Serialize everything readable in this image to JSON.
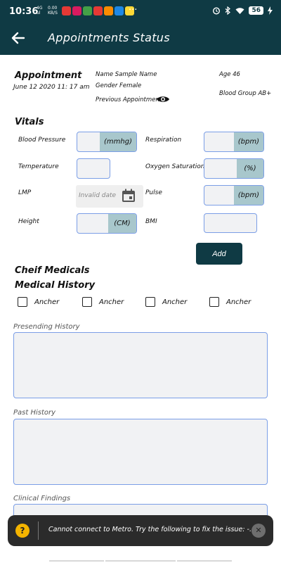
{
  "statusbar": {
    "time": "10:36",
    "signal_top": "4G",
    "signal_bottom": "ul",
    "net_top": "0.00",
    "net_bottom": "KB/S",
    "more": "···",
    "battery": "56",
    "notif_colors": [
      "#e53935",
      "#d81b60",
      "#43a047",
      "#e53935",
      "#fb8c00",
      "#1e88e5",
      "#fdd835"
    ]
  },
  "appbar": {
    "title": "Appointments Status"
  },
  "appointment": {
    "title": "Appointment",
    "date": "June 12 2020 11: 17 am",
    "name": "Name Sample Name",
    "gender": "Gender Female",
    "previous": "Previous Appointment",
    "age": "Age 46",
    "blood_group": "Blood Group AB+"
  },
  "vitals": {
    "title": "Vitals",
    "blood_pressure": {
      "label": "Blood Pressure",
      "unit": "(mmhg)"
    },
    "respiration": {
      "label": "Respiration",
      "unit": "(bpm)"
    },
    "temperature": {
      "label": "Temperature"
    },
    "oxygen": {
      "label": "Oxygen Saturation",
      "unit": "(%)"
    },
    "lmp": {
      "label": "LMP",
      "placeholder": "Invalid date"
    },
    "pulse": {
      "label": "Pulse",
      "unit": "(bpm)"
    },
    "height": {
      "label": "Height",
      "unit": "(CM)"
    },
    "bmi": {
      "label": "BMI"
    },
    "add_label": "Add"
  },
  "chief_medicals": {
    "title": "Cheif Medicals"
  },
  "medical_history": {
    "title": "Medical History",
    "options": [
      "Ancher",
      "Ancher",
      "Ancher",
      "Ancher"
    ]
  },
  "sections": {
    "presenting": "Presending History",
    "past": "Past History",
    "clinical": "Clinical Findings"
  },
  "toast": {
    "message": "Cannot connect to Metro.  Try the following to fix the issue: -...",
    "icon": "?",
    "close": "✕"
  },
  "colors": {
    "primary": "#0f3a44",
    "unit_bg": "#a8c7cc",
    "field_border": "#7b9ee6"
  }
}
